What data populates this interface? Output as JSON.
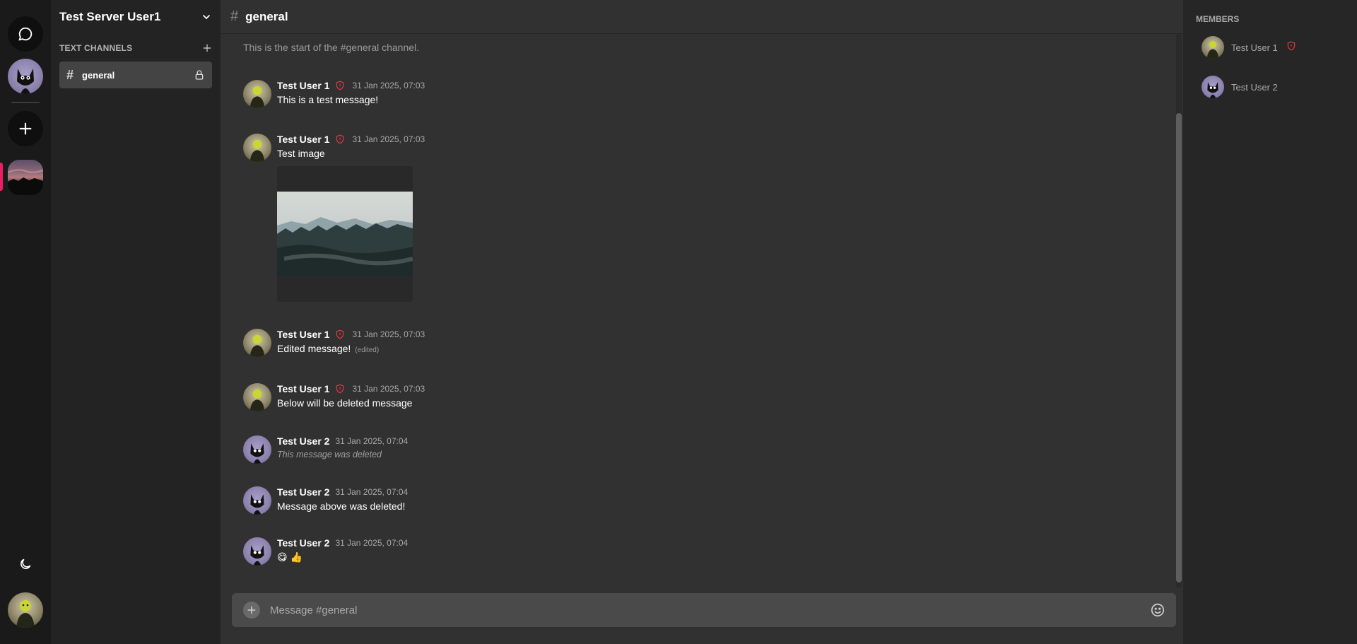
{
  "app": {
    "server_name": "Test Server User1",
    "channel_name": "general"
  },
  "rail": {
    "icons": [
      "chat-bubble-icon",
      "plus-icon",
      "moon-icon"
    ]
  },
  "sidebar": {
    "section_title": "TEXT CHANNELS",
    "channels": [
      {
        "label": "general",
        "active": true,
        "locked": true
      }
    ]
  },
  "chat": {
    "intro": "This is the start of the #general channel.",
    "messages": [
      {
        "author": "Test User 1",
        "admin": true,
        "time": "31 Jan 2025, 07:03",
        "text": "This is a test message!"
      },
      {
        "author": "Test User 1",
        "admin": true,
        "time": "31 Jan 2025, 07:03",
        "text": "Test image",
        "attachment": "image"
      },
      {
        "author": "Test User 1",
        "admin": true,
        "time": "31 Jan 2025, 07:03",
        "text": "Edited message!",
        "edited_label": "(edited)"
      },
      {
        "author": "Test User 1",
        "admin": true,
        "time": "31 Jan 2025, 07:03",
        "text": "Below will be deleted message"
      },
      {
        "author": "Test User 2",
        "admin": false,
        "time": "31 Jan 2025, 07:04",
        "text": "This message was deleted",
        "deleted": true
      },
      {
        "author": "Test User 2",
        "admin": false,
        "time": "31 Jan 2025, 07:04",
        "text": "Message above was deleted!"
      },
      {
        "author": "Test User 2",
        "admin": false,
        "time": "31 Jan 2025, 07:04",
        "text": "😋 👍"
      }
    ]
  },
  "composer": {
    "placeholder": "Message #general"
  },
  "members": {
    "title": "MEMBERS",
    "list": [
      {
        "name": "Test User 1",
        "admin": true
      },
      {
        "name": "Test User 2",
        "admin": false
      }
    ]
  },
  "colors": {
    "accent": "#e91e63",
    "admin_shield": "#e53946"
  }
}
